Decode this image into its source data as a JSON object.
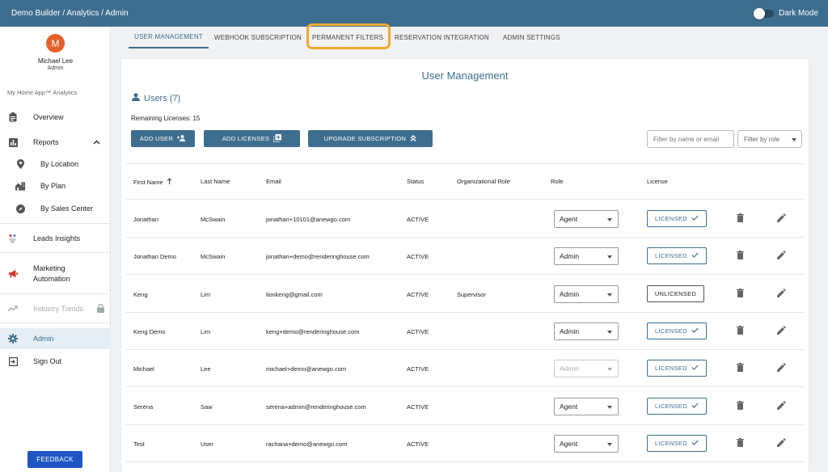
{
  "header": {
    "breadcrumb": "Demo Builder / Analytics / Admin",
    "dark_mode_label": "Dark Mode"
  },
  "sidebar": {
    "avatar_initial": "M",
    "user_name": "Michael Lee",
    "user_role": "Admin",
    "app_name": "My Home App™ Analytics",
    "items": {
      "overview": "Overview",
      "reports": "Reports",
      "by_location": "By Location",
      "by_plan": "By Plan",
      "by_sales_center": "By Sales Center",
      "leads_insights": "Leads Insights",
      "marketing_automation_1": "Marketing",
      "marketing_automation_2": "Automation",
      "industry_trends": "Industry Trends",
      "admin": "Admin",
      "sign_out": "Sign Out"
    },
    "feedback_label": "FEEDBACK"
  },
  "tabs": {
    "user_management": "USER MANAGEMENT",
    "webhook": "WEBHOOK SUBSCRIPTION",
    "permanent_filters": "PERMANENT FILTERS",
    "reservation": "RESERVATION INTEGRATION",
    "admin_settings": "ADMIN SETTINGS"
  },
  "main": {
    "title": "User Management",
    "users_label": "Users (7)",
    "remaining_licenses": "Remaining Licenses: 15",
    "add_user": "ADD USER",
    "add_licenses": "ADD LICENSES",
    "upgrade_subscription": "UPGRADE SUBSCRIPTION",
    "filter_placeholder": "Filter by name or email",
    "role_filter": "Filter by role"
  },
  "table": {
    "columns": {
      "first_name": "First Name",
      "last_name": "Last Name",
      "email": "Email",
      "status": "Status",
      "org_role": "Organizational Role",
      "role": "Role",
      "license": "License"
    },
    "rows": [
      {
        "first": "Jonathan",
        "last": "McSwain",
        "email": "jonathan+10101@anewgo.com",
        "status": "ACTIVE",
        "org_role": "",
        "role": "Agent",
        "license": "LICENSED"
      },
      {
        "first": "Jonathan Demo",
        "last": "McSwain",
        "email": "jonathan+demo@renderinghouse.com",
        "status": "ACTIVE",
        "org_role": "",
        "role": "Admin",
        "license": "LICENSED"
      },
      {
        "first": "Keng",
        "last": "Lim",
        "email": "lionkeng@gmail.com",
        "status": "ACTIVE",
        "org_role": "Supervisor",
        "role": "Admin",
        "license": "UNLICENSED"
      },
      {
        "first": "Keng Demo",
        "last": "Lim",
        "email": "keng+demo@renderinghouse.com",
        "status": "ACTIVE",
        "org_role": "",
        "role": "Admin",
        "license": "LICENSED"
      },
      {
        "first": "Michael",
        "last": "Lee",
        "email": "michael+demo@anewgo.com",
        "status": "ACTIVE",
        "org_role": "",
        "role": "Admin",
        "license": "LICENSED"
      },
      {
        "first": "Serena",
        "last": "Saw",
        "email": "serena+admin@renderinghouse.com",
        "status": "ACTIVE",
        "org_role": "",
        "role": "Agent",
        "license": "LICENSED"
      },
      {
        "first": "Test",
        "last": "User",
        "email": "rachana+demo@anewgo.com",
        "status": "ACTIVE",
        "org_role": "",
        "role": "Agent",
        "license": "LICENSED"
      }
    ]
  },
  "colors": {
    "primary": "#3e6e8f",
    "highlight": "#f0a830",
    "avatar": "#e5602a",
    "feedback": "#1f56c4"
  }
}
